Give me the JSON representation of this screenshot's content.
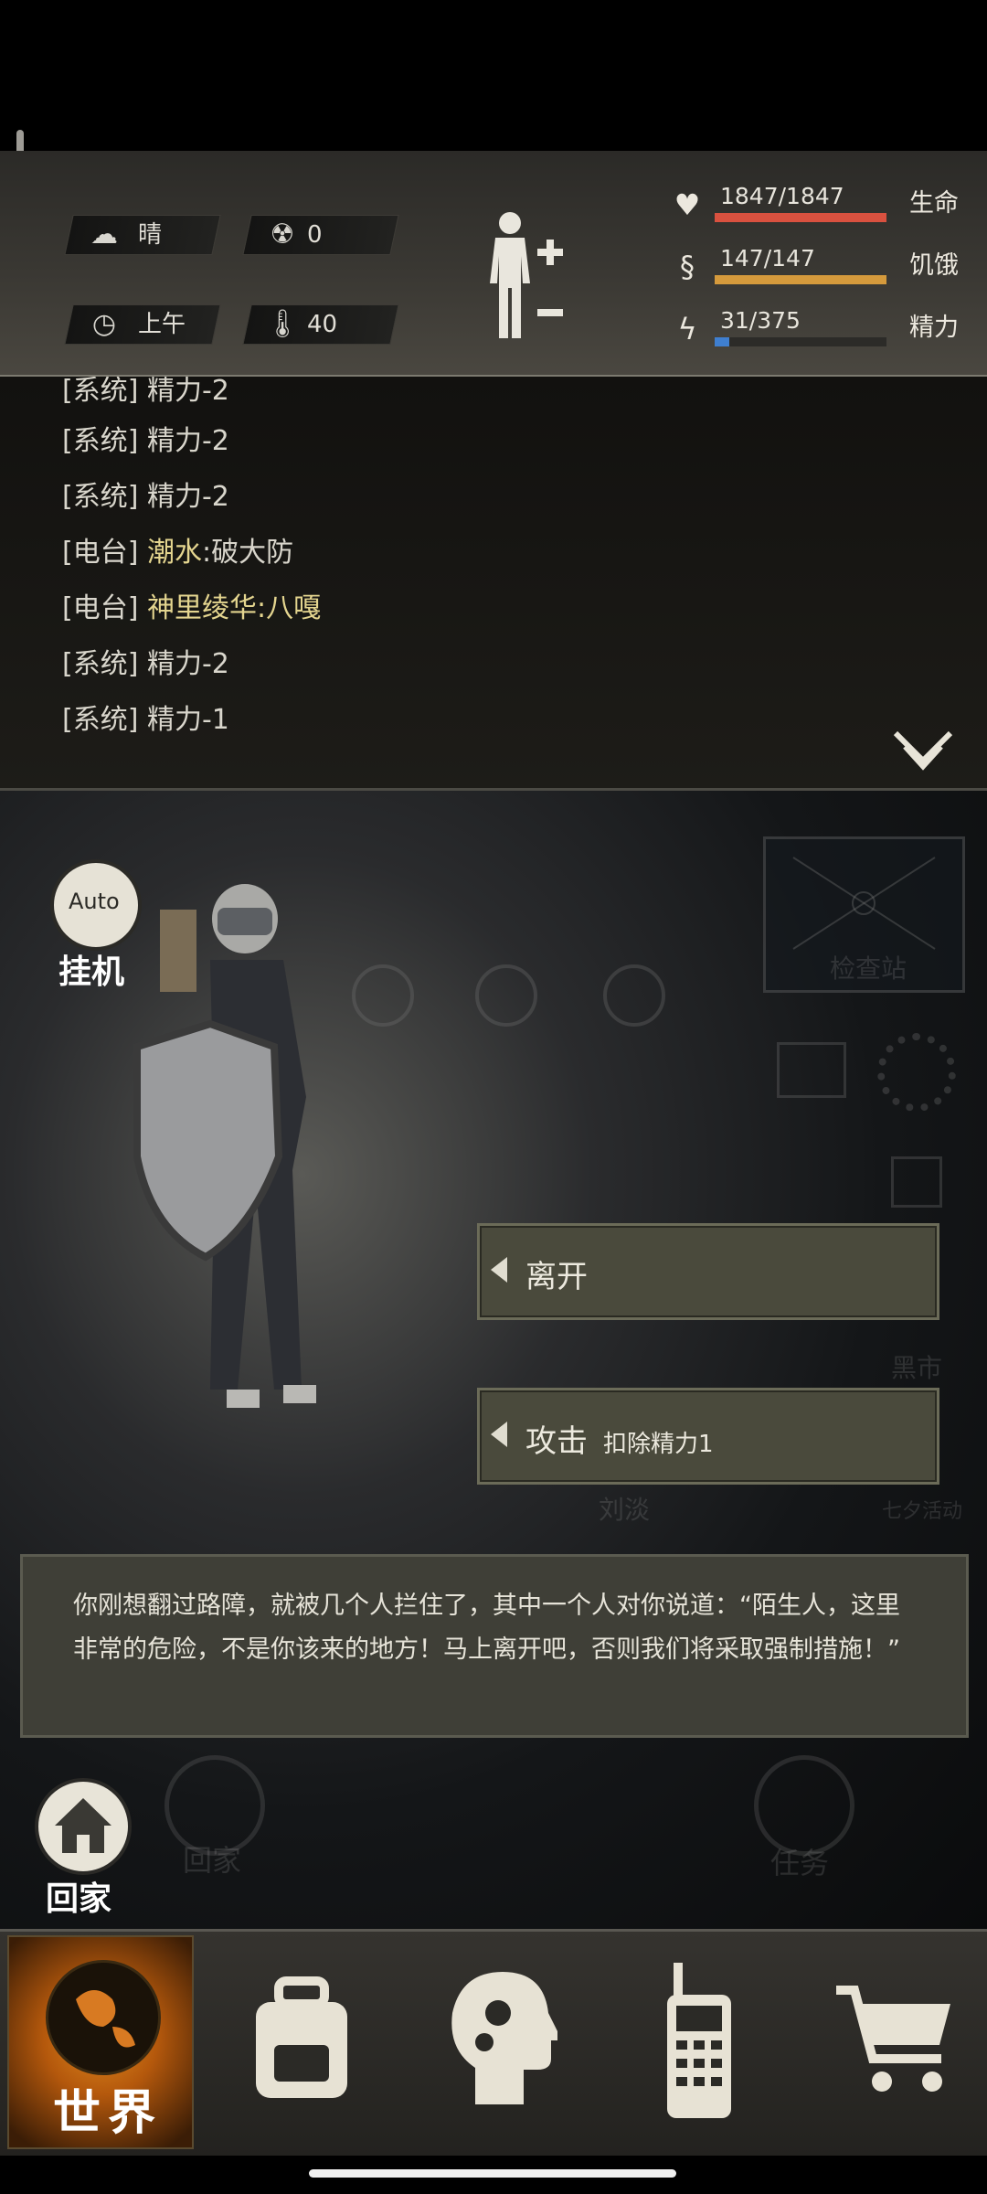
{
  "status": {
    "weather": {
      "icon": "cloud-sun-icon",
      "value": "晴"
    },
    "radiation": {
      "icon": "radiation-icon",
      "value": "0"
    },
    "time": {
      "icon": "clock-icon",
      "value": "上午"
    },
    "temperature": {
      "icon": "thermometer-icon",
      "value": "40"
    },
    "body": {
      "plus": "+",
      "minus": "−"
    },
    "stats": [
      {
        "label": "生命",
        "value": "1847/1847",
        "current": 1847,
        "max": 1847,
        "color": "#d9513f",
        "icon": "heart-icon"
      },
      {
        "label": "饥饿",
        "value": "147/147",
        "current": 147,
        "max": 147,
        "color": "#d59a3c",
        "icon": "stomach-icon"
      },
      {
        "label": "精力",
        "value": "31/375",
        "current": 31,
        "max": 375,
        "color": "#3f7fd0",
        "icon": "energy-icon"
      }
    ]
  },
  "log": {
    "lines": [
      {
        "tag": "[系统]",
        "text": "精力-2",
        "speaker": ""
      },
      {
        "tag": "[系统]",
        "text": "精力-2",
        "speaker": ""
      },
      {
        "tag": "[系统]",
        "text": "精力-2",
        "speaker": ""
      },
      {
        "tag": "[电台]",
        "speaker": "潮水",
        "text": ":破大防"
      },
      {
        "tag": "[电台]",
        "speaker": "神里绫华",
        "text": ":八嘎"
      },
      {
        "tag": "[系统]",
        "text": "精力-2",
        "speaker": ""
      },
      {
        "tag": "[系统]",
        "text": "精力-1",
        "speaker": ""
      }
    ],
    "expand_icon": "double-chevron-down-icon"
  },
  "scene": {
    "auto_badge": "Auto",
    "auto_label": "挂机",
    "bg_labels": {
      "checkpoint": "检查站",
      "black_market": "黑市",
      "event": "七夕活动",
      "home_ghost": "回家",
      "task_ghost": "任务",
      "sign_name": "刘淡"
    },
    "choices": [
      {
        "label": "离开",
        "sub": ""
      },
      {
        "label": "攻击",
        "sub": "扣除精力1"
      }
    ],
    "dialog": "你刚想翻过路障，就被几个人拦住了，其中一个人对你说道：“陌生人，这里非常的危险，不是你该来的地方！马上离开吧，否则我们将采取强制措施！”",
    "home_button": "回家"
  },
  "nav": {
    "items": [
      {
        "label": "世界",
        "icon": "globe-icon",
        "active": true
      },
      {
        "label": "",
        "icon": "backpack-icon"
      },
      {
        "label": "",
        "icon": "head-gears-icon"
      },
      {
        "label": "",
        "icon": "radio-icon"
      },
      {
        "label": "",
        "icon": "cart-icon"
      }
    ]
  }
}
